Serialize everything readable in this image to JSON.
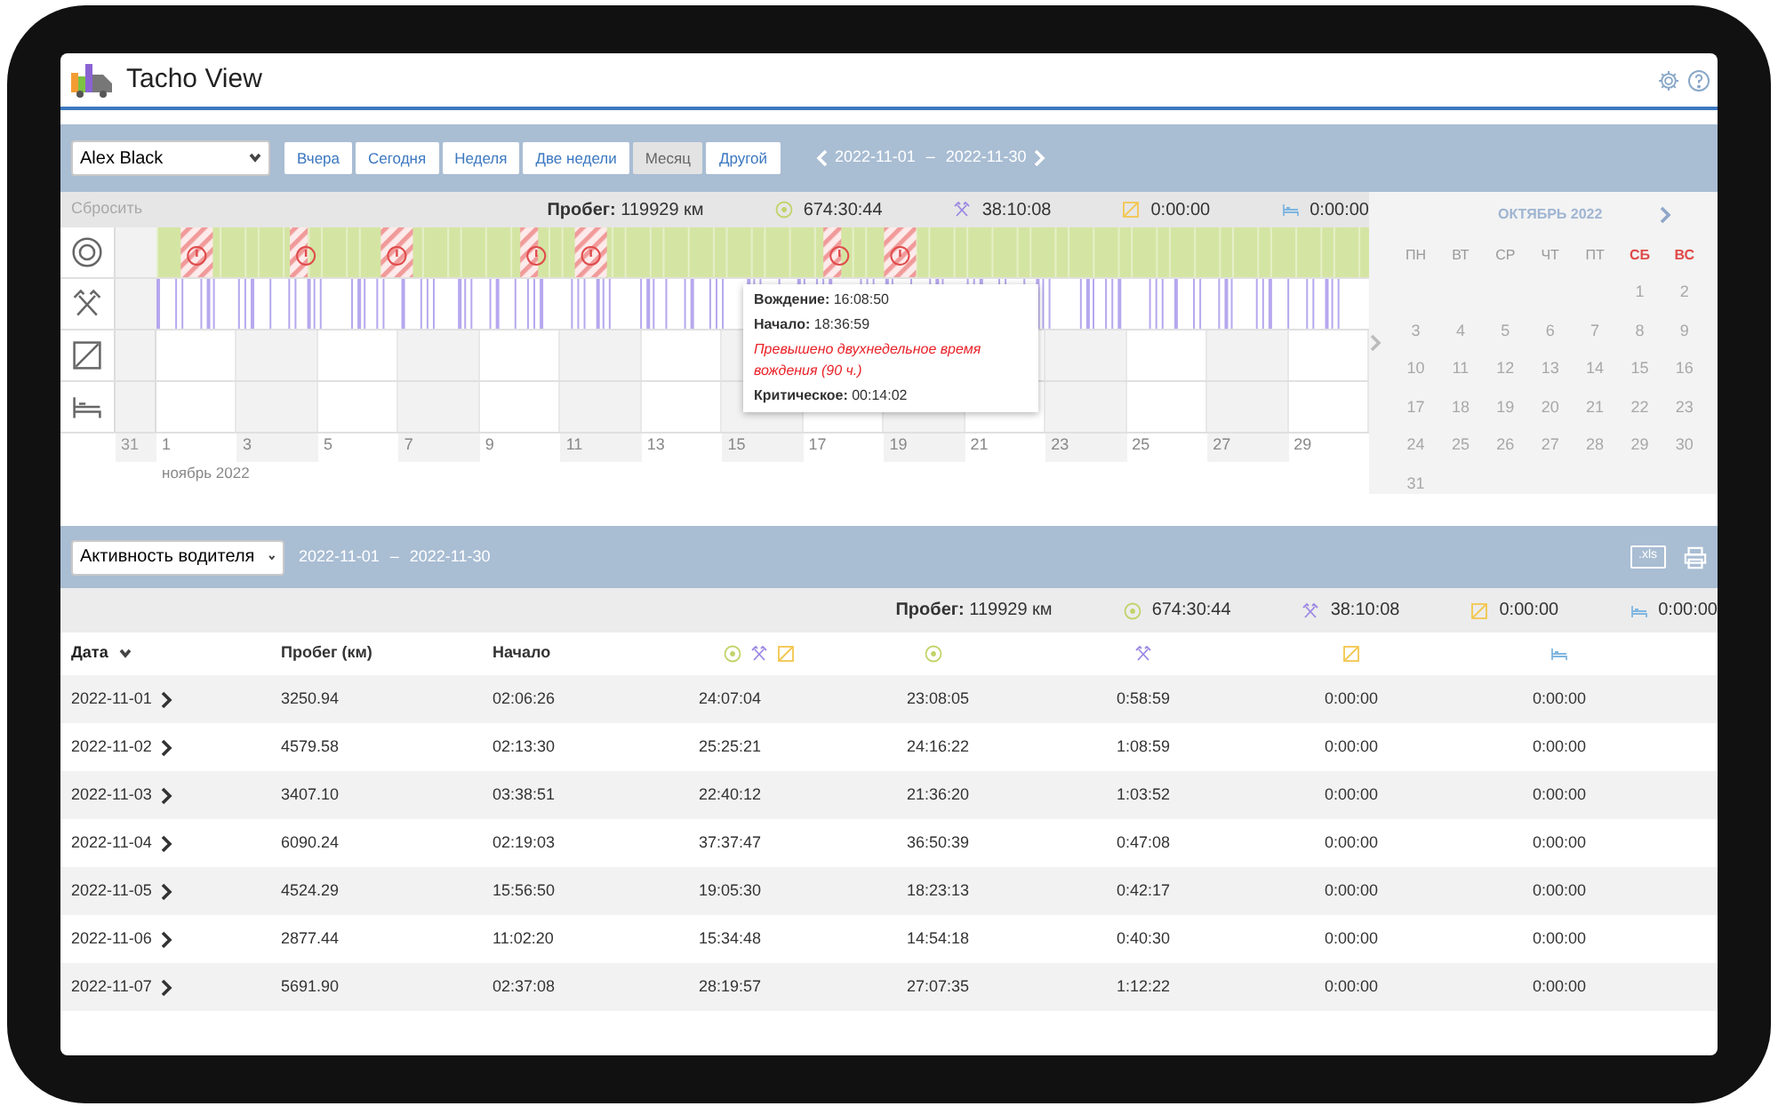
{
  "app": {
    "title": "Tacho View"
  },
  "toolbar": {
    "driver": "Alex Black",
    "periods": [
      {
        "label": "Вчера",
        "selected": false
      },
      {
        "label": "Сегодня",
        "selected": false
      },
      {
        "label": "Неделя",
        "selected": false
      },
      {
        "label": "Две недели",
        "selected": false
      },
      {
        "label": "Месяц",
        "selected": true
      },
      {
        "label": "Другой",
        "selected": false
      }
    ],
    "date_from": "2022-11-01",
    "date_sep": "–",
    "date_to": "2022-11-30"
  },
  "timeline": {
    "reset": {
      "label": "Сбросить",
      "disabled": true
    },
    "mileage": "**Пробег:** 119929 км",
    "stats": [
      {
        "kind": "driving",
        "value": "674:30:44"
      },
      {
        "kind": "work",
        "value": "38:10:08"
      },
      {
        "kind": "availability",
        "value": "0:00:00"
      },
      {
        "kind": "rest",
        "value": "0:00:00"
      }
    ],
    "rows": [
      {
        "kind": "driving"
      },
      {
        "kind": "work"
      },
      {
        "kind": "availability"
      },
      {
        "kind": "rest"
      }
    ],
    "first_label": "31",
    "axis_labels": [
      "1",
      "3",
      "5",
      "7",
      "9",
      "11",
      "13",
      "15",
      "17",
      "19",
      "21",
      "23",
      "25",
      "27",
      "29"
    ],
    "month": "ноябрь 2022",
    "tooltip": {
      "lines": [
        {
          "kind": "line",
          "text": "**Вождение:** 16:08:50"
        },
        {
          "kind": "line",
          "text": "**Начало:** 18:36:59"
        },
        {
          "kind": "warning",
          "text": "Превышено двухнедельное время вождения (90 ч.)"
        },
        {
          "kind": "line",
          "text": "**Критическое:** 00:14:02"
        }
      ]
    }
  },
  "calendar": {
    "month": "ОКТЯБРЬ 2022",
    "weekdays": [
      {
        "label": "ПН",
        "weekend": false
      },
      {
        "label": "ВТ",
        "weekend": false
      },
      {
        "label": "СР",
        "weekend": false
      },
      {
        "label": "ЧТ",
        "weekend": false
      },
      {
        "label": "ПТ",
        "weekend": false
      },
      {
        "label": "СБ",
        "weekend": true
      },
      {
        "label": "ВС",
        "weekend": true
      }
    ],
    "weeks": [
      {
        "kind": "end",
        "days": [
          "1",
          "2"
        ]
      },
      {
        "kind": "start",
        "days": [
          "3",
          "4",
          "5",
          "6",
          "7",
          "8",
          "9"
        ]
      },
      {
        "kind": "start",
        "days": [
          "10",
          "11",
          "12",
          "13",
          "14",
          "15",
          "16"
        ]
      },
      {
        "kind": "start",
        "days": [
          "17",
          "18",
          "19",
          "20",
          "21",
          "22",
          "23"
        ]
      },
      {
        "kind": "start",
        "days": [
          "24",
          "25",
          "26",
          "27",
          "28",
          "29",
          "30"
        ]
      },
      {
        "kind": "start",
        "days": [
          "31"
        ]
      }
    ]
  },
  "report": {
    "type": "Активность водителя",
    "date_from": "2022-11-01",
    "date_sep": "–",
    "date_to": "2022-11-30",
    "export": ".xls",
    "mileage": "**Пробег:** 119929 км",
    "stats": [
      {
        "kind": "driving",
        "value": "674:30:44"
      },
      {
        "kind": "work",
        "value": "38:10:08"
      },
      {
        "kind": "availability",
        "value": "0:00:00"
      },
      {
        "kind": "rest",
        "value": "0:00:00"
      }
    ],
    "columns": [
      {
        "kind": "text",
        "label": "Дата",
        "sortable": true
      },
      {
        "kind": "text",
        "label": "Пробег (км)",
        "sortable": false
      },
      {
        "kind": "text",
        "label": "Начало",
        "sortable": false
      },
      {
        "kind": "combined"
      },
      {
        "kind": "driving"
      },
      {
        "kind": "work"
      },
      {
        "kind": "availability"
      },
      {
        "kind": "rest"
      }
    ],
    "rows": [
      {
        "cells": [
          "2022-11-01",
          "3250.94",
          "02:06:26",
          "24:07:04",
          "23:08:05",
          "0:58:59",
          "0:00:00",
          "0:00:00"
        ]
      },
      {
        "cells": [
          "2022-11-02",
          "4579.58",
          "02:13:30",
          "25:25:21",
          "24:16:22",
          "1:08:59",
          "0:00:00",
          "0:00:00"
        ]
      },
      {
        "cells": [
          "2022-11-03",
          "3407.10",
          "03:38:51",
          "22:40:12",
          "21:36:20",
          "1:03:52",
          "0:00:00",
          "0:00:00"
        ]
      },
      {
        "cells": [
          "2022-11-04",
          "6090.24",
          "02:19:03",
          "37:37:47",
          "36:50:39",
          "0:47:08",
          "0:00:00",
          "0:00:00"
        ]
      },
      {
        "cells": [
          "2022-11-05",
          "4524.29",
          "15:56:50",
          "19:05:30",
          "18:23:13",
          "0:42:17",
          "0:00:00",
          "0:00:00"
        ]
      },
      {
        "cells": [
          "2022-11-06",
          "2877.44",
          "11:02:20",
          "15:34:48",
          "14:54:18",
          "0:40:30",
          "0:00:00",
          "0:00:00"
        ]
      },
      {
        "cells": [
          "2022-11-07",
          "5691.90",
          "02:37:08",
          "28:19:57",
          "27:07:35",
          "1:12:22",
          "0:00:00",
          "0:00:00"
        ]
      }
    ]
  }
}
